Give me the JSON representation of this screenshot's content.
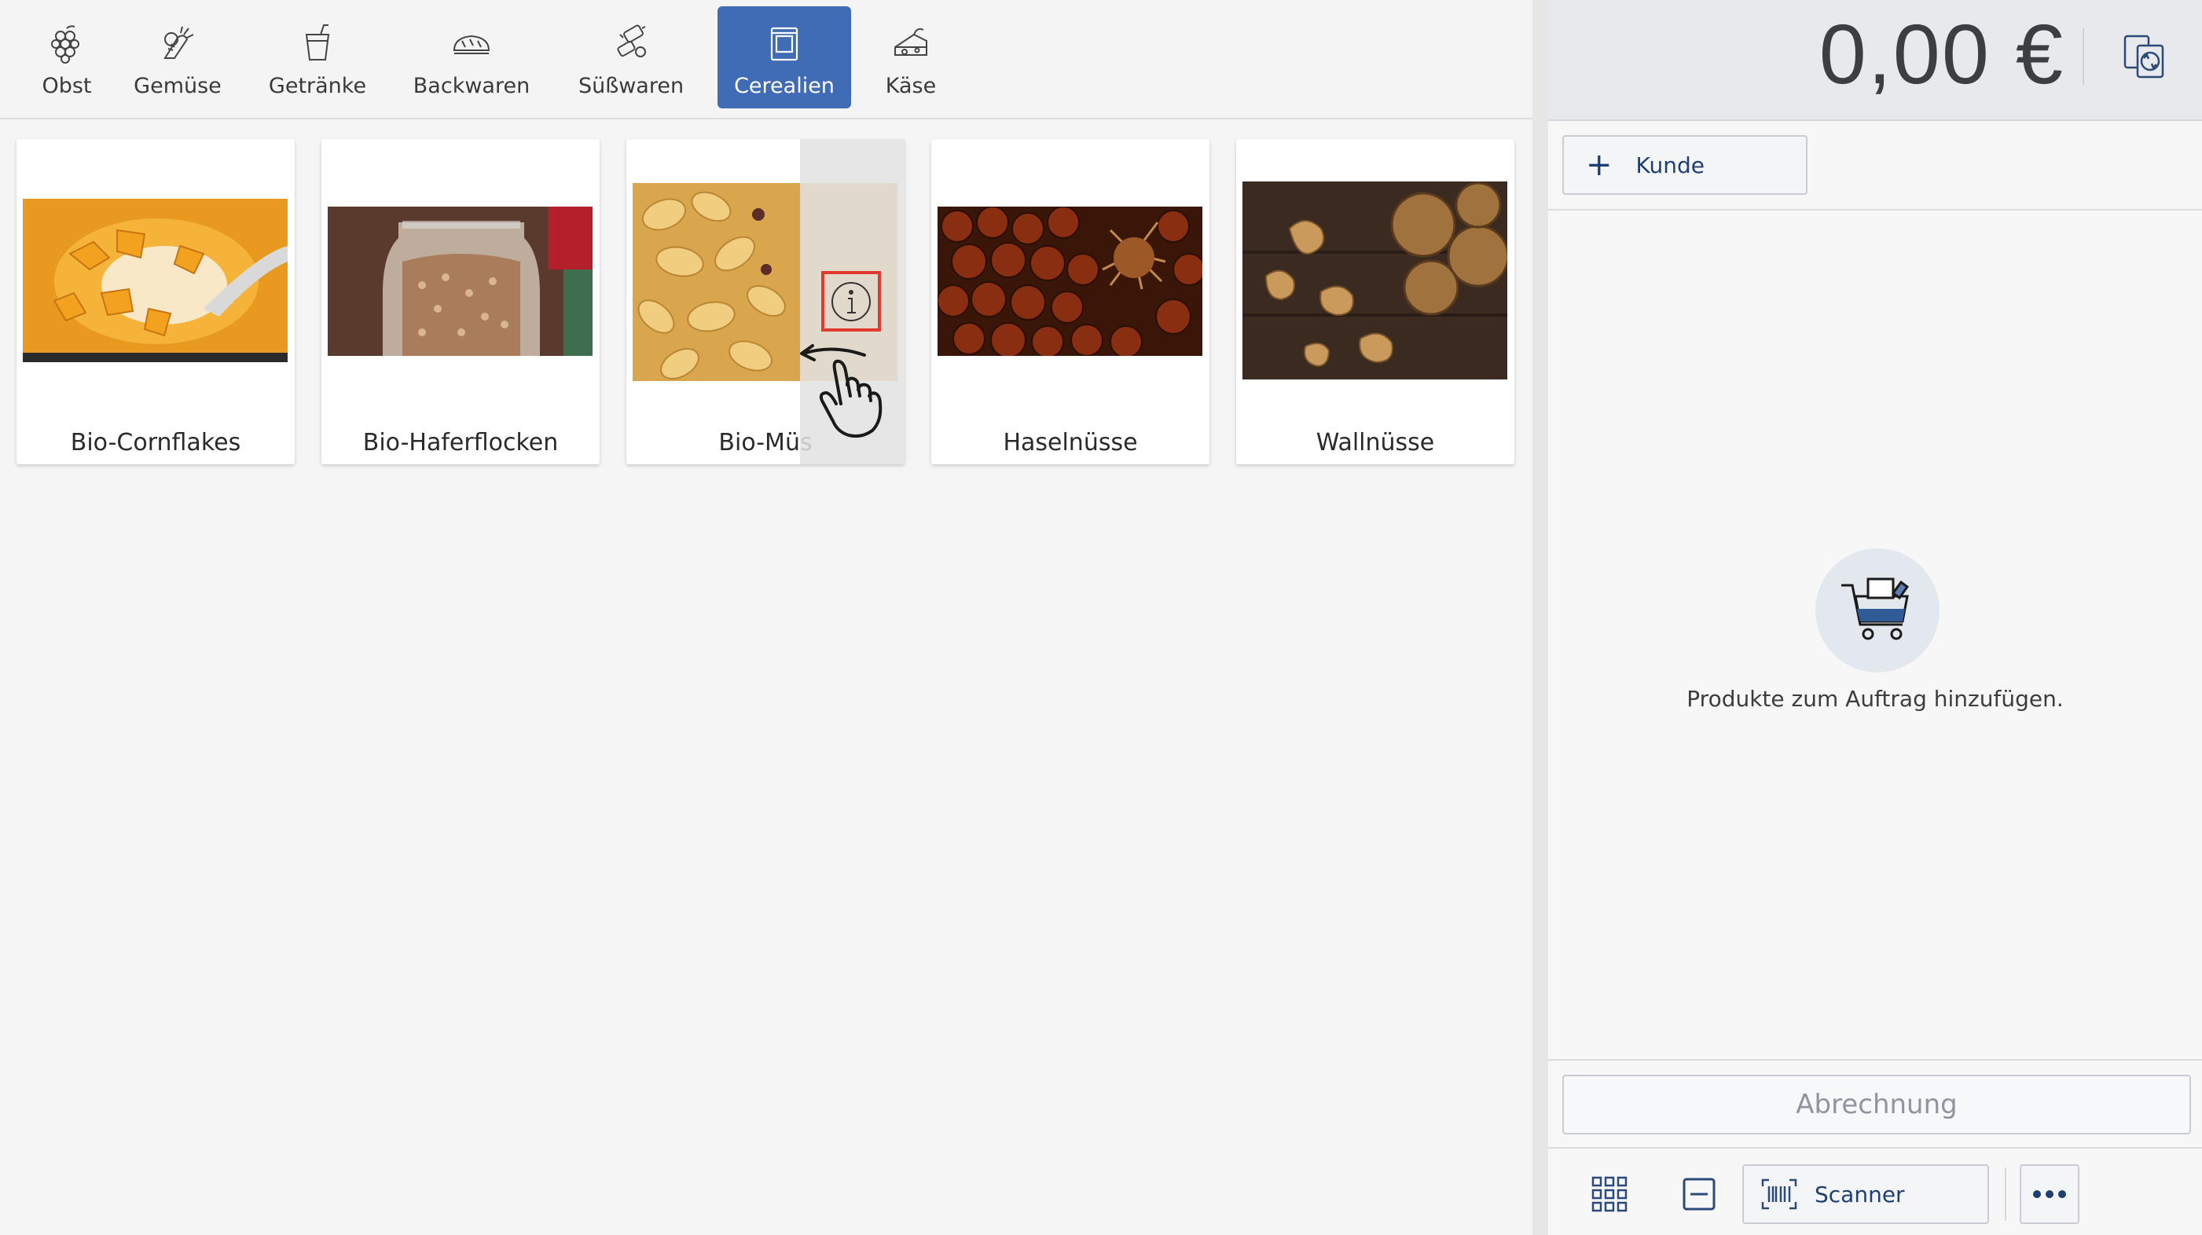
{
  "categories": [
    {
      "label": "Obst",
      "icon": "grapes-icon"
    },
    {
      "label": "Gemüse",
      "icon": "vegetables-icon"
    },
    {
      "label": "Getränke",
      "icon": "drink-cup-icon"
    },
    {
      "label": "Backwaren",
      "icon": "bread-icon"
    },
    {
      "label": "Süßwaren",
      "icon": "candy-icon"
    },
    {
      "label": "Cerealien",
      "icon": "cereal-box-icon",
      "active": true
    },
    {
      "label": "Käse",
      "icon": "cheese-icon"
    }
  ],
  "products": [
    {
      "name": "Bio-Cornflakes",
      "image": "cornflakes-photo"
    },
    {
      "name": "Bio-Haferflocken",
      "image": "oatmeal-jar-photo"
    },
    {
      "name": "Bio-Müsli",
      "name_visible": "Bio-Müs",
      "image": "muesli-photo"
    },
    {
      "name": "Haselnüsse",
      "image": "hazelnuts-photo"
    },
    {
      "name": "Wallnüsse",
      "image": "walnuts-photo"
    }
  ],
  "swipe_hint": {
    "icon": "info-icon",
    "gesture": "swipe-left-hand-icon",
    "highlight_color": "#e03a2f"
  },
  "order": {
    "total": "0,00 €",
    "customer_button": "Kunde",
    "empty_message": "Produkte zum Auftrag hinzufügen.",
    "checkout_button": "Abrechnung"
  },
  "footer": {
    "grid_icon": "grid-view-icon",
    "minus_icon": "minus-box-icon",
    "scanner_label": "Scanner",
    "more_icon": "more-dots-icon"
  },
  "colors": {
    "accent": "#3f6cb5",
    "brand_text": "#1f3f73",
    "highlight": "#e03a2f"
  }
}
